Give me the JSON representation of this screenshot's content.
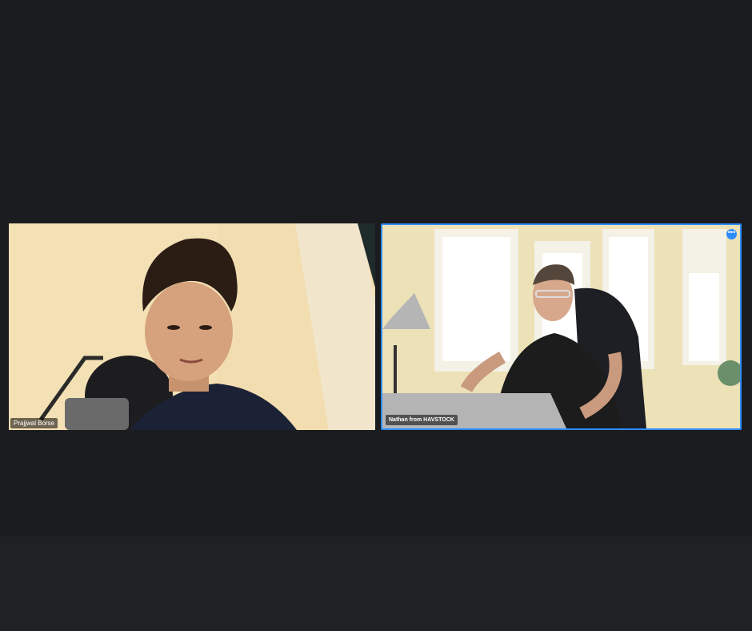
{
  "meeting": {
    "participants": [
      {
        "name": "Prajjwal Borse",
        "active_speaker": false
      },
      {
        "name": "Nathan from HAVSTOCK",
        "active_speaker": true
      }
    ],
    "more_options_icon": "ellipsis-icon",
    "more_options_glyph": "•••"
  },
  "colors": {
    "background": "#1b1c1f",
    "active_speaker_border": "#2d8cff"
  }
}
